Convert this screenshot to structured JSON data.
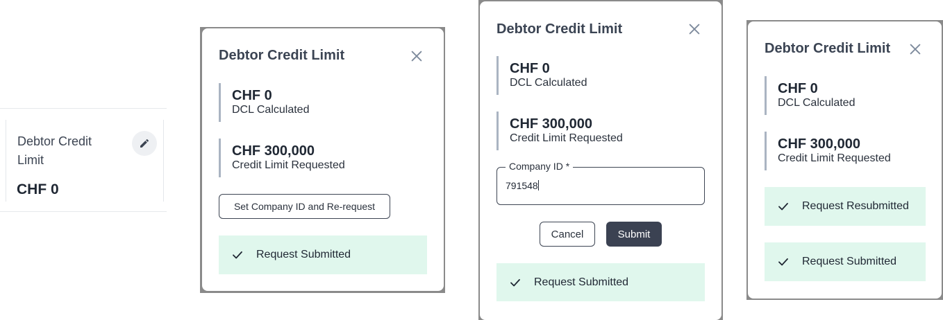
{
  "colors": {
    "success_bg": "#e0f7ed",
    "stat_border": "#aab4c2",
    "primary_button": "#3b4252",
    "title_text": "#3b4453"
  },
  "card": {
    "title": "Debtor Credit Limit",
    "value": "CHF 0",
    "edit_icon": "pencil-icon"
  },
  "dialog1": {
    "title": "Debtor Credit Limit",
    "close_icon": "close-icon",
    "stats": [
      {
        "value": "CHF 0",
        "label": "DCL Calculated"
      },
      {
        "value": "CHF 300,000",
        "label": "Credit Limit Requested"
      }
    ],
    "action_button": "Set Company ID and Re-request",
    "success": [
      {
        "icon": "check-icon",
        "text": "Request Submitted"
      }
    ]
  },
  "dialog2": {
    "title": "Debtor Credit Limit",
    "close_icon": "close-icon",
    "stats": [
      {
        "value": "CHF 0",
        "label": "DCL Calculated"
      },
      {
        "value": "CHF 300,000",
        "label": "Credit Limit Requested"
      }
    ],
    "company_field": {
      "label": "Company ID *",
      "value": "791548"
    },
    "cancel_label": "Cancel",
    "submit_label": "Submit",
    "success": [
      {
        "icon": "check-icon",
        "text": "Request Submitted"
      }
    ]
  },
  "dialog3": {
    "title": "Debtor Credit Limit",
    "close_icon": "close-icon",
    "stats": [
      {
        "value": "CHF 0",
        "label": "DCL Calculated"
      },
      {
        "value": "CHF 300,000",
        "label": "Credit Limit Requested"
      }
    ],
    "success": [
      {
        "icon": "check-icon",
        "text": "Request Resubmitted"
      },
      {
        "icon": "check-icon",
        "text": "Request Submitted"
      }
    ]
  }
}
